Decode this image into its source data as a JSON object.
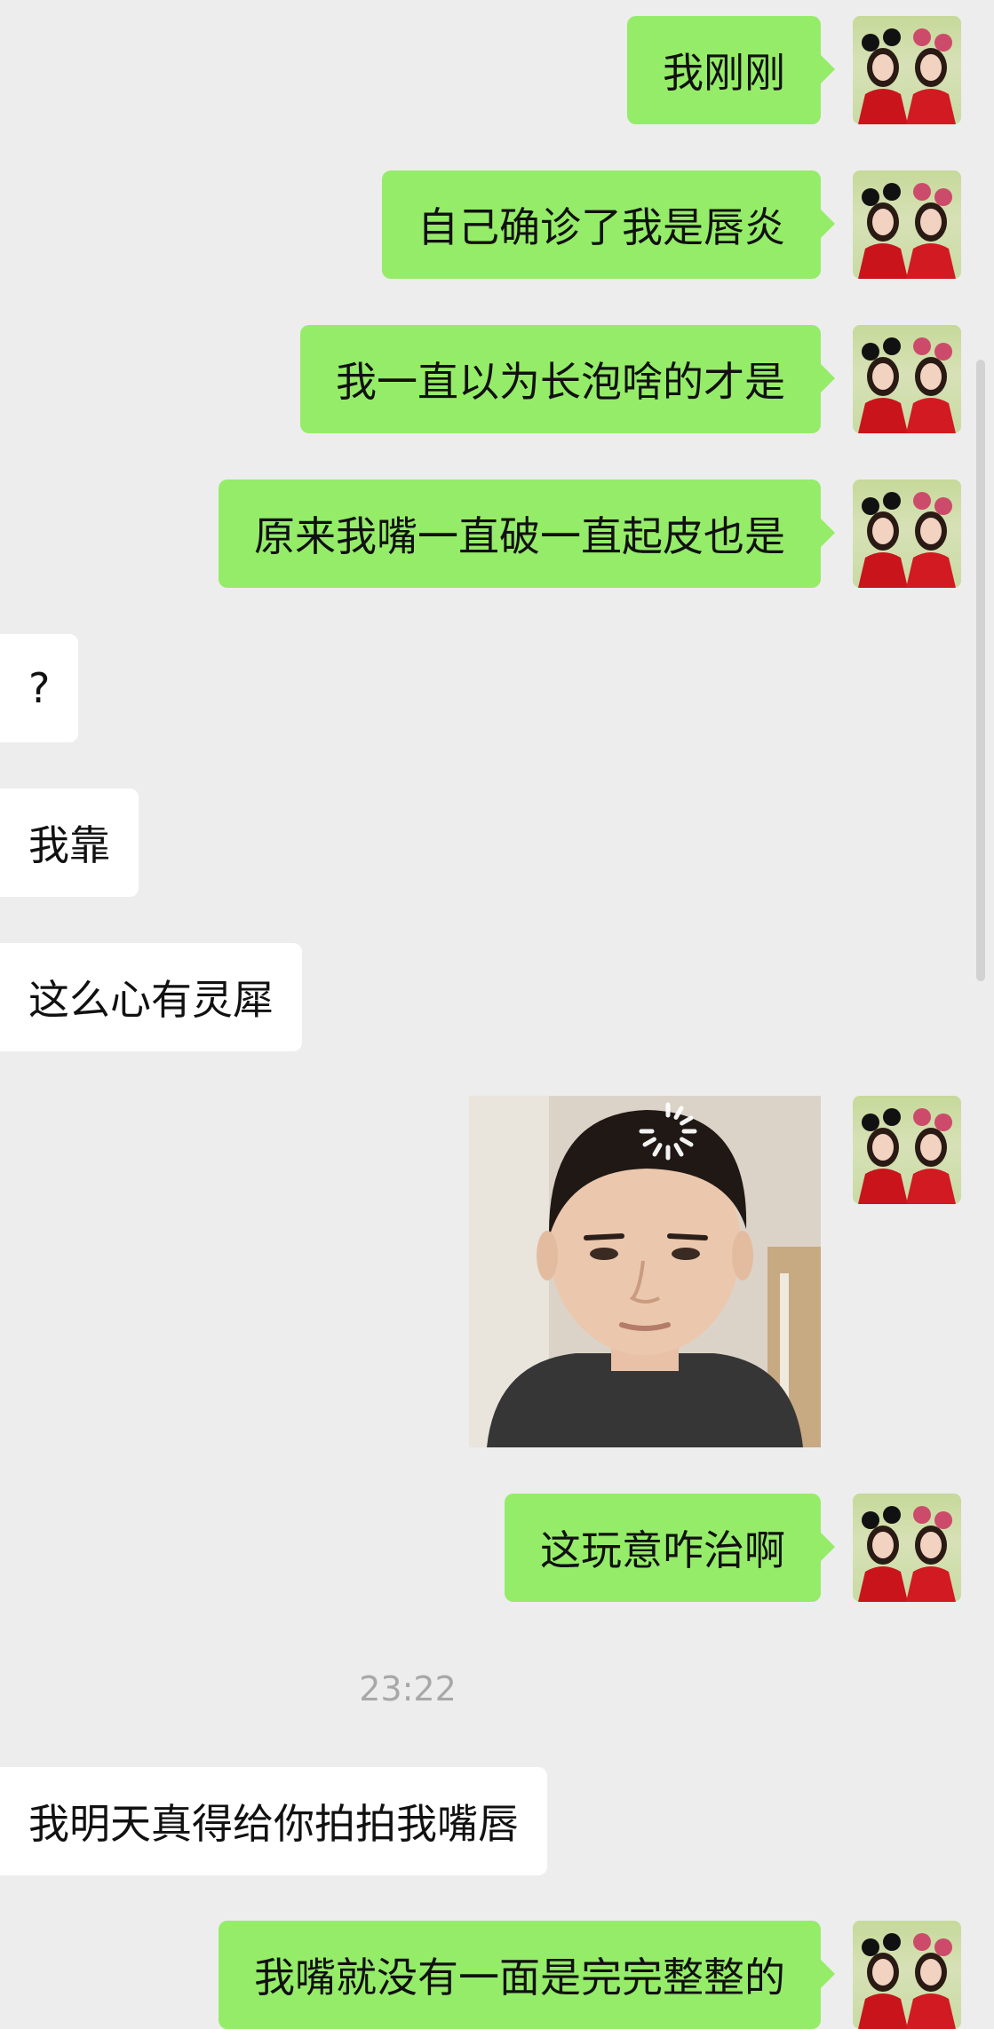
{
  "messages": [
    {
      "text": "我刚刚"
    },
    {
      "text": "自己确诊了我是唇炎"
    },
    {
      "text": "我一直以为长泡啥的才是"
    },
    {
      "text": "原来我嘴一直破一直起皮也是"
    },
    {
      "text": "?"
    },
    {
      "text": "我靠"
    },
    {
      "text": "这么心有灵犀"
    },
    {
      "text": "这玩意咋治啊"
    },
    {
      "text": "我明天真得给你拍拍我嘴唇"
    },
    {
      "text": "我嘴就没有一面是完完整整的"
    }
  ],
  "timestamp": "23:22",
  "colors": {
    "background": "#ededed",
    "outgoing_bubble": "#95ec69",
    "incoming_bubble": "#ffffff",
    "timestamp_text": "#a8a8a8"
  }
}
